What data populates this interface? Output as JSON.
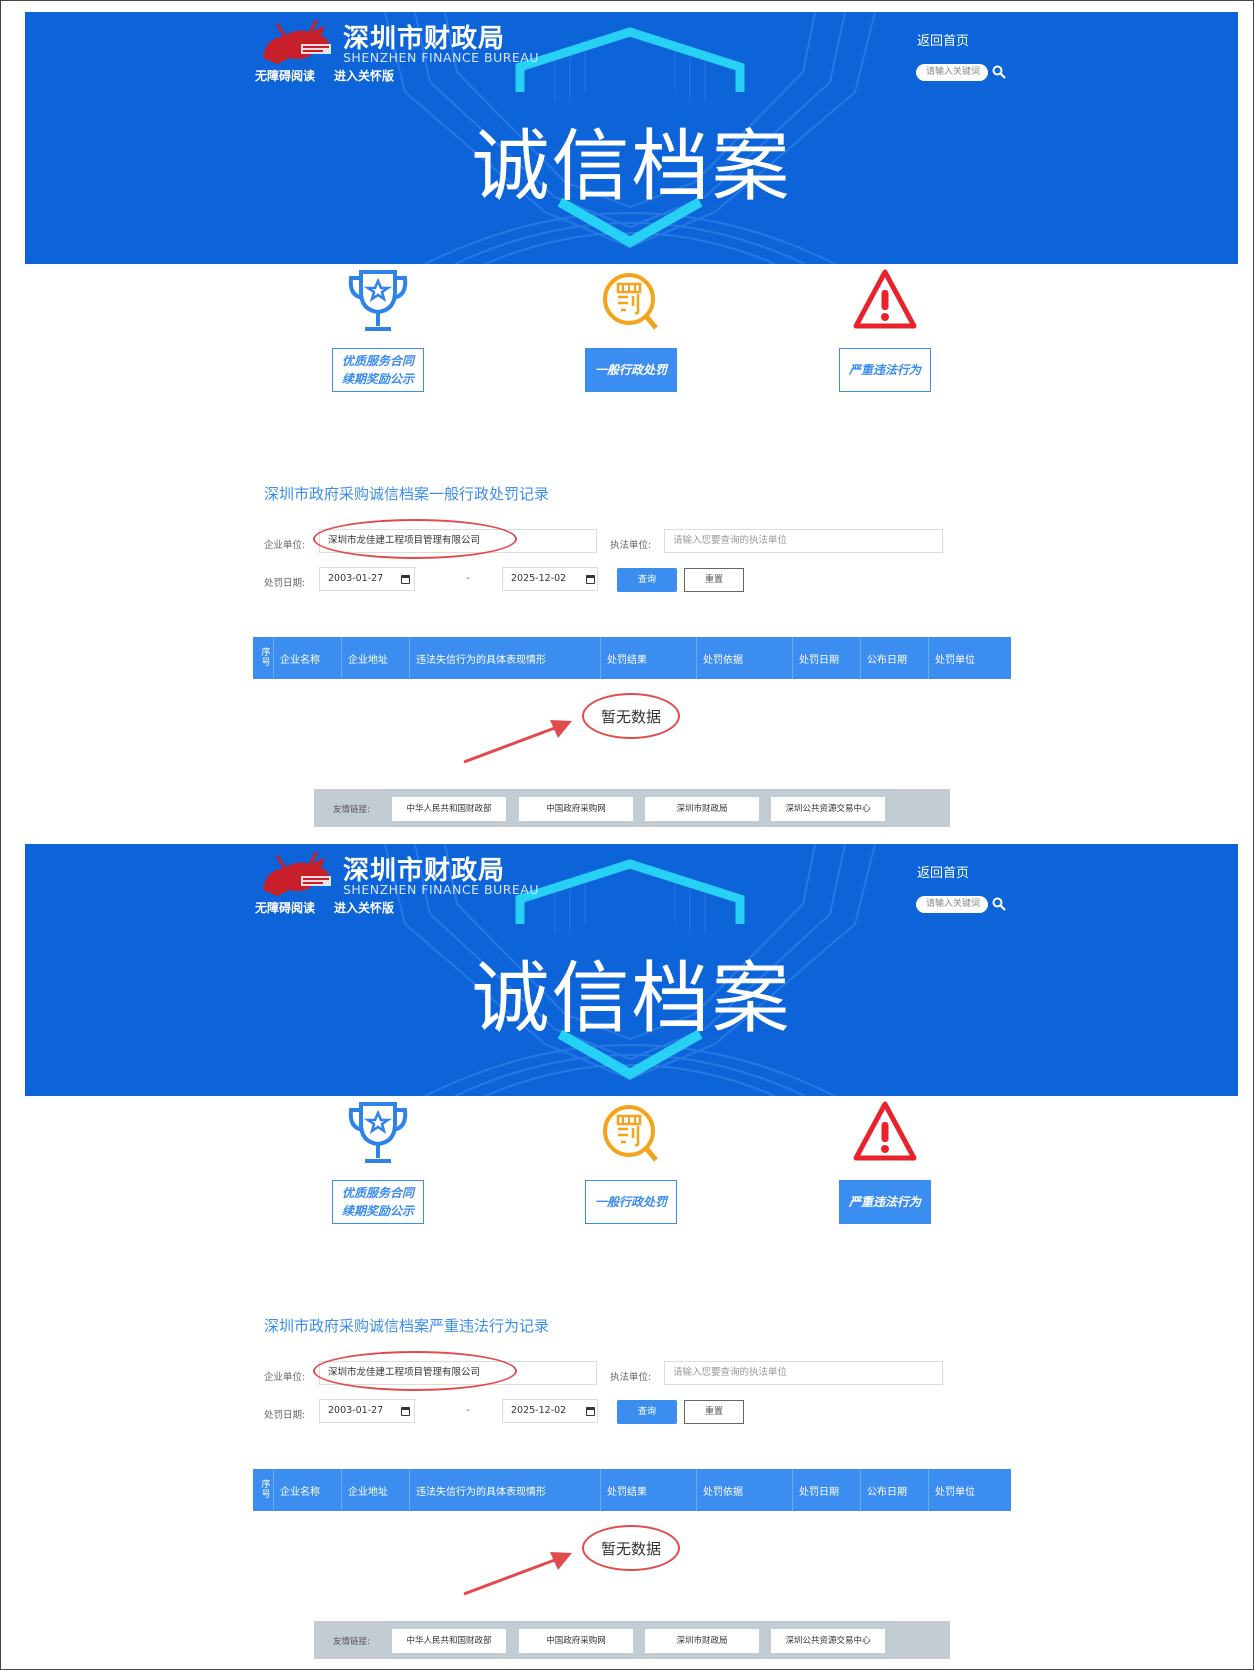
{
  "site": {
    "title": "深圳市财政局",
    "subtitle": "SHENZHEN FINANCE BUREAU",
    "accessibility_link": "无障碍阅读",
    "care_mode_link": "进入关怀版",
    "home_link": "返回首页",
    "search_placeholder": "请输入关键词",
    "banner_title": "诚信档案"
  },
  "categories": [
    {
      "label_line1": "优质服务合同",
      "label_line2": "续期奖励公示",
      "icon": "trophy-icon"
    },
    {
      "label_line1": "一般行政处罚",
      "label_line2": "",
      "icon": "penalty-icon"
    },
    {
      "label_line1": "严重违法行为",
      "label_line2": "",
      "icon": "warning-icon"
    }
  ],
  "panels": [
    {
      "section_title": "深圳市政府采购诚信档案一般行政处罚记录",
      "active_category": 1
    },
    {
      "section_title": "深圳市政府采购诚信档案严重违法行为记录",
      "active_category": 2
    }
  ],
  "form": {
    "company_label": "企业单位:",
    "company_value": "深圳市龙佳建工程项目管理有限公司",
    "enforcer_label": "执法单位:",
    "enforcer_placeholder": "请输入您要查询的执法单位",
    "date_label": "处罚日期:",
    "date_from": "2003-01-27",
    "date_sep": "-",
    "date_to": "2025-12-02",
    "query_button": "查询",
    "reset_button": "重置"
  },
  "table": {
    "columns": [
      "序号",
      "企业名称",
      "企业地址",
      "违法失信行为的具体表现情形",
      "处罚结果",
      "处罚依据",
      "处罚日期",
      "公布日期",
      "处罚单位"
    ],
    "index_top": "序",
    "index_bottom": "号",
    "empty_text": "暂无数据"
  },
  "footer": {
    "label": "友情链接:",
    "links": [
      "中华人民共和国财政部",
      "中国政府采购网",
      "深圳市财政局",
      "深圳公共资源交易中心"
    ]
  },
  "colors": {
    "banner": "#0d64d8",
    "accent": "#3b8df0",
    "annotation_red": "#e24b4b",
    "footer_bg": "#c3cbd3"
  }
}
